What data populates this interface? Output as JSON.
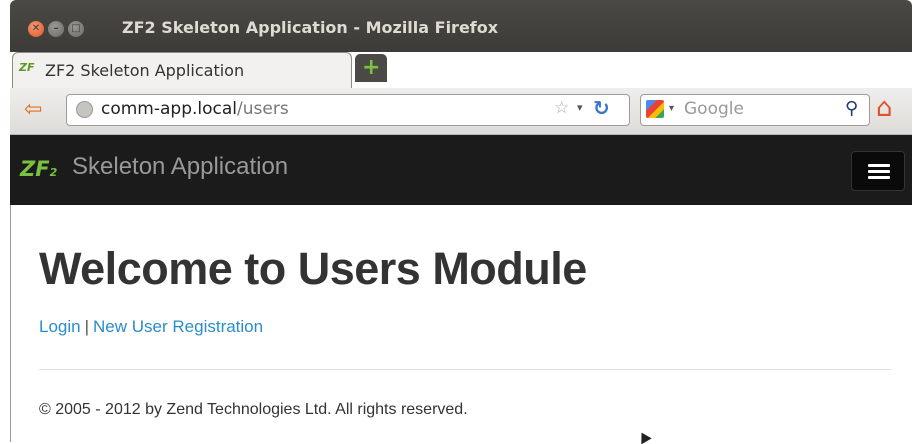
{
  "window": {
    "title": "ZF2 Skeleton Application - Mozilla Firefox",
    "close_glyph": "✕",
    "min_glyph": "–",
    "max_glyph": "□"
  },
  "tab": {
    "icon_text": "ZF",
    "title": "ZF2 Skeleton Application",
    "new_tab_glyph": "+"
  },
  "navbar": {
    "back_glyph": "⇦",
    "url_host": "comm-app.local",
    "url_path": "/users",
    "star_glyph": "☆",
    "dropdown_glyph": "▾",
    "reload_glyph": "↻",
    "search_placeholder": "Google",
    "search_dropdown_glyph": "▾",
    "search_glyph": "🔍",
    "home_glyph": "⌂"
  },
  "app": {
    "logo": "Z",
    "logo_sub": "F",
    "logo_num": "2",
    "brand": "Skeleton Application"
  },
  "content": {
    "heading": "Welcome to Users Module",
    "links": [
      {
        "label": "Login"
      },
      {
        "label": "New User Registration"
      }
    ],
    "separator": "|",
    "footer": "© 2005 - 2012 by Zend Technologies Ltd. All rights reserved."
  },
  "icons": [
    "close-icon",
    "minimize-icon",
    "maximize-icon",
    "zf-favicon-icon",
    "plus-icon",
    "back-arrow-icon",
    "globe-icon",
    "star-icon",
    "chevron-down-icon",
    "reload-icon",
    "google-icon",
    "search-icon",
    "home-icon",
    "zf-logo-icon",
    "hamburger-icon"
  ],
  "colors": {
    "link": "#2a8ccd",
    "app_nav_bg": "#1b1b1b",
    "zf_green": "#7ac142",
    "titlebar_bg": "#3c3b37"
  }
}
